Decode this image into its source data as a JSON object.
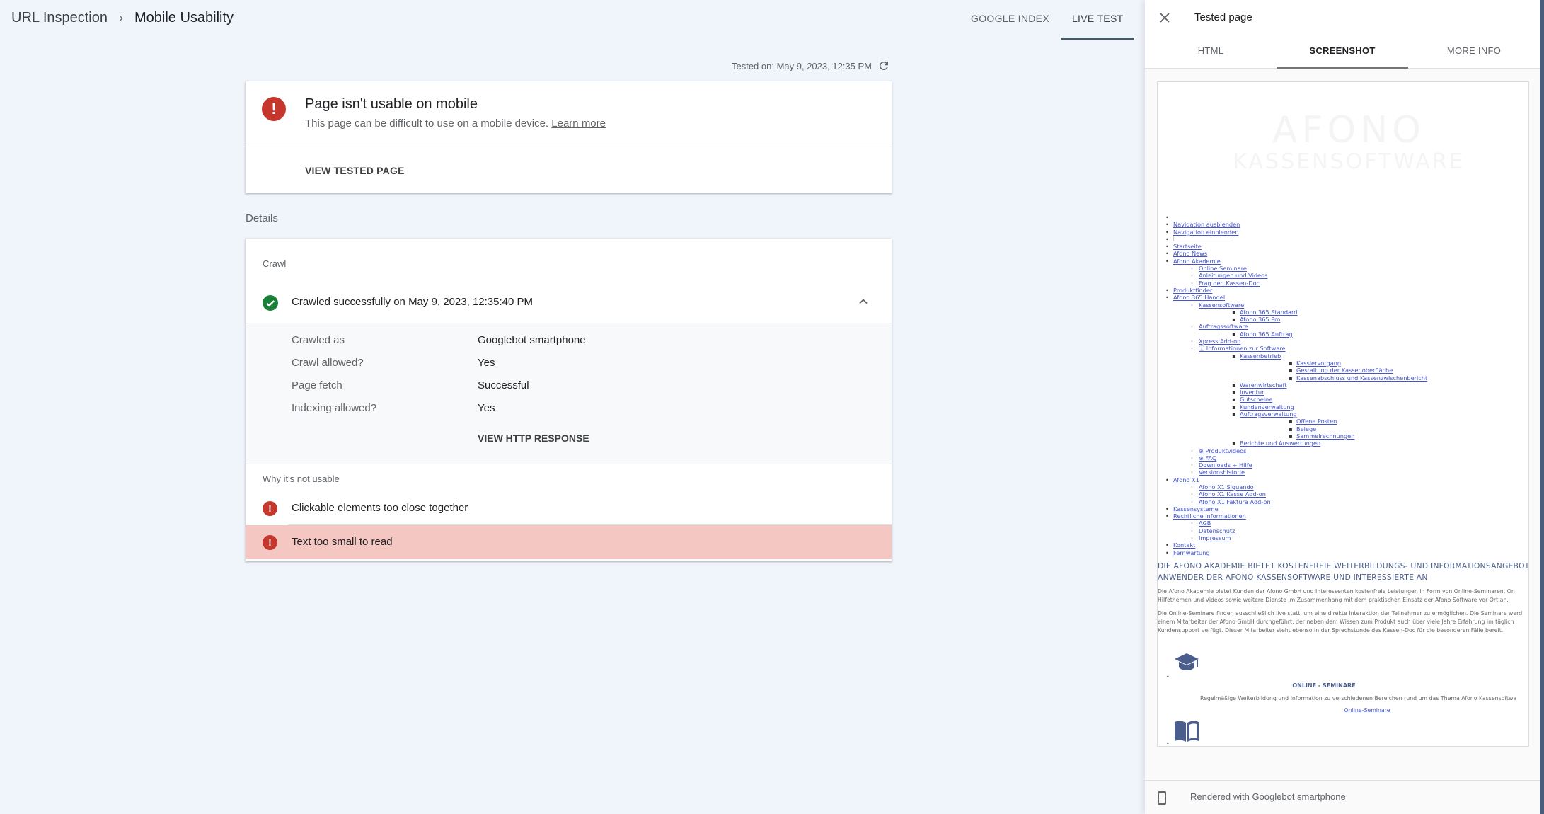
{
  "header": {
    "breadcrumb": [
      "URL Inspection",
      "Mobile Usability"
    ],
    "breadcrumb_separator": "›",
    "tabs": [
      {
        "label": "GOOGLE INDEX",
        "active": false
      },
      {
        "label": "LIVE TEST",
        "active": true
      }
    ]
  },
  "tested_on": "Tested on: May 9, 2023, 12:35 PM",
  "status": {
    "icon": "error-icon",
    "title": "Page isn't usable on mobile",
    "subtitle": "This page can be difficult to use on a mobile device.",
    "learn_more": "Learn more",
    "view_tested_page": "VIEW TESTED PAGE",
    "error_color": "#c5372c"
  },
  "details": {
    "label": "Details",
    "crawl": {
      "section_label": "Crawl",
      "summary": "Crawled successfully on May 9, 2023, 12:35:40 PM",
      "success_color": "#188038",
      "rows": [
        {
          "key": "Crawled as",
          "value": "Googlebot smartphone"
        },
        {
          "key": "Crawl allowed?",
          "value": "Yes"
        },
        {
          "key": "Page fetch",
          "value": "Successful"
        },
        {
          "key": "Indexing allowed?",
          "value": "Yes"
        }
      ],
      "view_http_response": "VIEW HTTP RESPONSE"
    },
    "issues": {
      "section_label": "Why it's not usable",
      "items": [
        {
          "label": "Clickable elements too close together",
          "selected": false
        },
        {
          "label": "Text too small to read",
          "selected": true
        }
      ],
      "highlight_color": "#f4c7c3"
    }
  },
  "panel": {
    "title": "Tested page",
    "tabs": [
      {
        "label": "HTML",
        "active": false
      },
      {
        "label": "SCREENSHOT",
        "active": true
      },
      {
        "label": "MORE INFO",
        "active": false
      }
    ],
    "footer": "Rendered with Googlebot smartphone",
    "preview": {
      "logo": [
        "AFONO",
        "KASSENSOFTWARE"
      ],
      "nav": [
        {
          "label": "",
          "level": 1
        },
        {
          "label": "Navigation ausblenden",
          "level": 1
        },
        {
          "label": "Navigation einblenden",
          "level": 1
        },
        {
          "label": "[search]",
          "level": 1
        },
        {
          "label": "Startseite",
          "level": 1
        },
        {
          "label": "Afono News",
          "level": 1
        },
        {
          "label": "Afono Akademie",
          "level": 1
        },
        {
          "label": "Online Seminare",
          "level": 2
        },
        {
          "label": "Anleitungen und Videos",
          "level": 2
        },
        {
          "label": "Frag den Kassen-Doc",
          "level": 2
        },
        {
          "label": "Produktfinder",
          "level": 1
        },
        {
          "label": "Afono 365 Handel",
          "level": 1
        },
        {
          "label": "Kassensoftware",
          "level": 2
        },
        {
          "label": "Afono 365 Standard",
          "level": 3
        },
        {
          "label": "Afono 365 Pro",
          "level": 3
        },
        {
          "label": "Auftragssoftware",
          "level": 2
        },
        {
          "label": "Afono 365 Auftrag",
          "level": 3
        },
        {
          "label": "Xpress Add-on",
          "level": 2
        },
        {
          "label": "ⓘ Informationen zur Software",
          "level": 2
        },
        {
          "label": "Kassenbetrieb",
          "level": 3
        },
        {
          "label": "Kassiervorgang",
          "level": 4
        },
        {
          "label": "Gestaltung der Kassenoberfläche",
          "level": 4
        },
        {
          "label": "Kassenabschluss und Kassenzwischenbericht",
          "level": 4
        },
        {
          "label": "Warenwirtschaft",
          "level": 3
        },
        {
          "label": "Inventur",
          "level": 3
        },
        {
          "label": "Gutscheine",
          "level": 3
        },
        {
          "label": "Kundenverwaltung",
          "level": 3
        },
        {
          "label": "Auftragsverwaltung",
          "level": 3
        },
        {
          "label": "Offene Posten",
          "level": 4
        },
        {
          "label": "Belege",
          "level": 4
        },
        {
          "label": "Sammelrechnungen",
          "level": 4
        },
        {
          "label": "Berichte und Auswertungen",
          "level": 3
        },
        {
          "label": "⊛ Produktvideos",
          "level": 2
        },
        {
          "label": "⊛ FAQ",
          "level": 2
        },
        {
          "label": "Downloads + Hilfe",
          "level": 2
        },
        {
          "label": "Versionshistorie",
          "level": 2
        },
        {
          "label": "Afono X1",
          "level": 1
        },
        {
          "label": "Afono X1 Siquando",
          "level": 2
        },
        {
          "label": "Afono X1 Kasse Add-on",
          "level": 2
        },
        {
          "label": "Afono X1 Faktura Add-on",
          "level": 2
        },
        {
          "label": "Kassensysteme",
          "level": 1
        },
        {
          "label": "Rechtliche Informationen",
          "level": 1
        },
        {
          "label": "AGB",
          "level": 2
        },
        {
          "label": "Datenschutz",
          "level": 2
        },
        {
          "label": "Impressum",
          "level": 2
        },
        {
          "label": "Kontakt",
          "level": 1
        },
        {
          "label": "Fernwartung",
          "level": 1
        }
      ],
      "heading": "DIE AFONO AKADEMIE BIETET KOSTENFREIE WEITERBILDUNGS- UND INFORMATIONSANGEBOTE ANWENDER DER AFONO KASSENSOFTWARE UND INTERESSIERTE AN",
      "paragraph1": [
        "Die Afono Akademie bietet Kunden der Afono GmbH und Interessenten kostenfreie Leistungen in Form von Online-Seminaren, On",
        "Hilfethemen und Videos sowie weitere Dienste im Zusammenhang mit dem praktischen Einsatz der Afono Software vor Ort an."
      ],
      "paragraph2": [
        "Die Online-Seminare finden ausschließlich live statt, um eine direkte Interaktion der Teilnehmer zu ermöglichen. Die Seminare werd",
        "einem Mitarbeiter der Afono GmbH durchgeführt, der neben dem Wissen zum Produkt auch über viele Jahre Erfahrung im täglich",
        "Kundensupport verfügt. Dieser Mitarbeiter steht ebenso in der Sprechstunde des Kassen-Doc für die besonderen Fälle bereit."
      ],
      "seminar_title": "ONLINE - SEMINARE",
      "seminar_desc": "Regelmäßige Weiterbildung und Information zu verschiedenen Bereichen rund um das Thema Afono Kassensoftwa",
      "seminar_link": "Online-Seminare"
    }
  }
}
